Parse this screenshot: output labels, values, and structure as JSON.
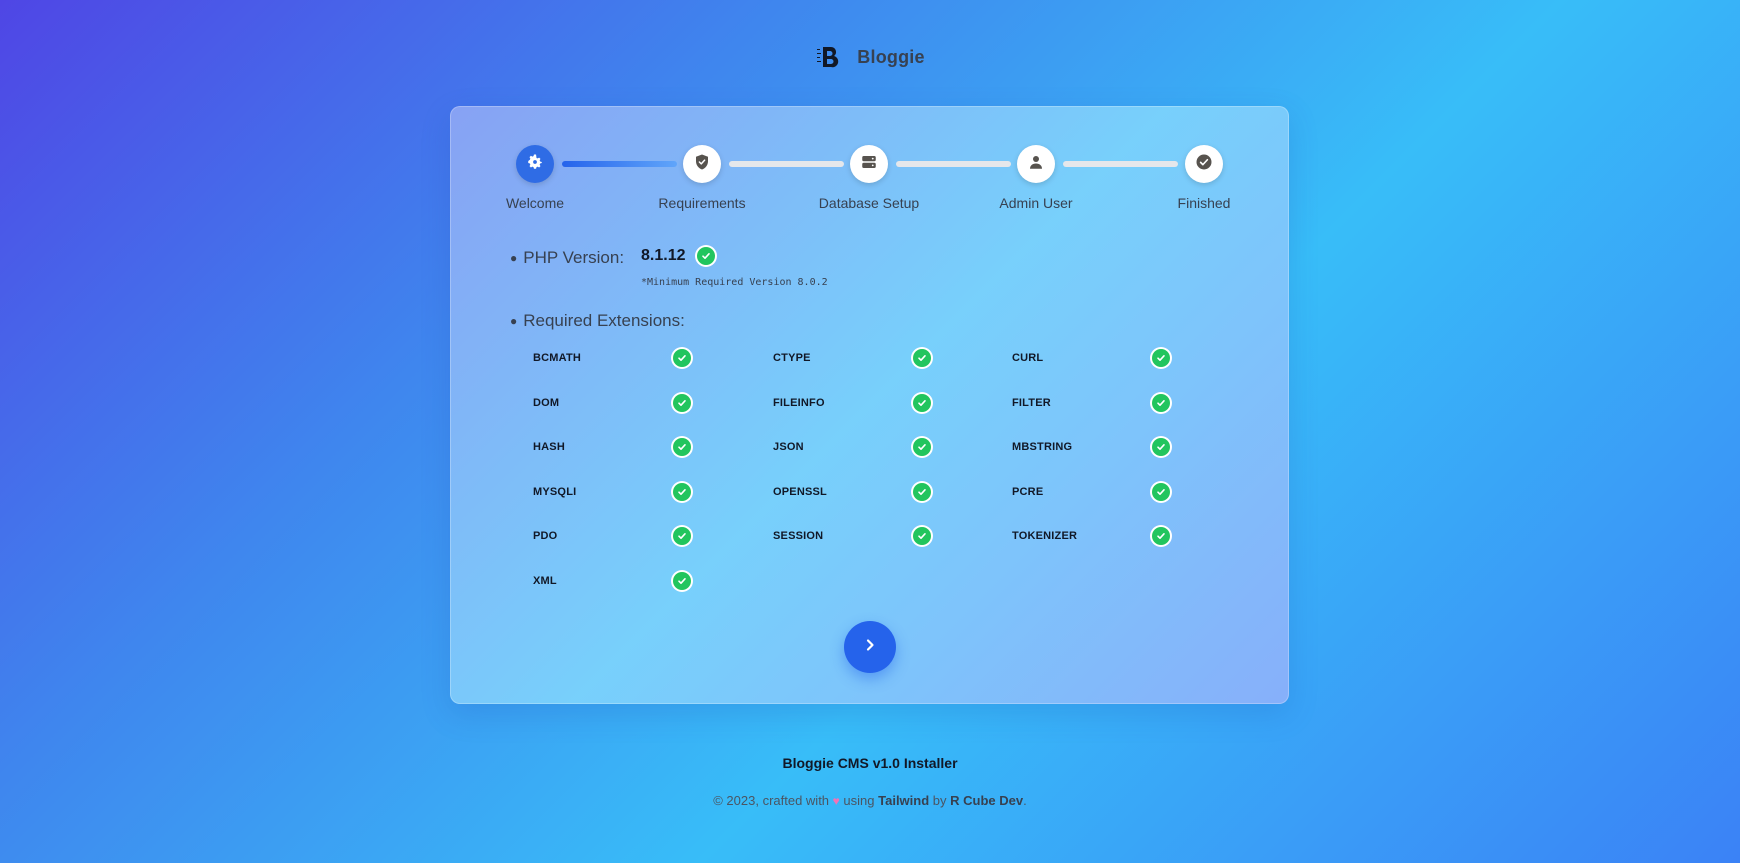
{
  "brand": {
    "name": "Bloggie"
  },
  "steps": [
    {
      "label": "Welcome",
      "icon": "gear-icon",
      "active": true
    },
    {
      "label": "Requirements",
      "icon": "shield-check-icon",
      "active": false
    },
    {
      "label": "Database Setup",
      "icon": "server-icon",
      "active": false
    },
    {
      "label": "Admin User",
      "icon": "user-icon",
      "active": false
    },
    {
      "label": "Finished",
      "icon": "check-circle-icon",
      "active": false
    }
  ],
  "php": {
    "label": "PHP Version:",
    "version": "8.1.12",
    "note": "*Minimum Required Version 8.0.2"
  },
  "extensions": {
    "title": "Required Extensions:",
    "items": [
      "BCMATH",
      "CTYPE",
      "CURL",
      "DOM",
      "FILEINFO",
      "FILTER",
      "HASH",
      "JSON",
      "MBSTRING",
      "MYSQLI",
      "OPENSSL",
      "PCRE",
      "PDO",
      "SESSION",
      "TOKENIZER",
      "XML"
    ]
  },
  "next_button": {
    "icon": "chevron-right-icon"
  },
  "footer": {
    "title": "Bloggie CMS v1.0 Installer",
    "copy_prefix": "© 2023, crafted with",
    "copy_using": "using",
    "tech": "Tailwind",
    "copy_by": "by",
    "author": "R Cube Dev",
    "copy_suffix": "."
  },
  "colors": {
    "accent": "#2563eb",
    "success": "#22c55e",
    "connector_idle": "#e5e7eb"
  }
}
